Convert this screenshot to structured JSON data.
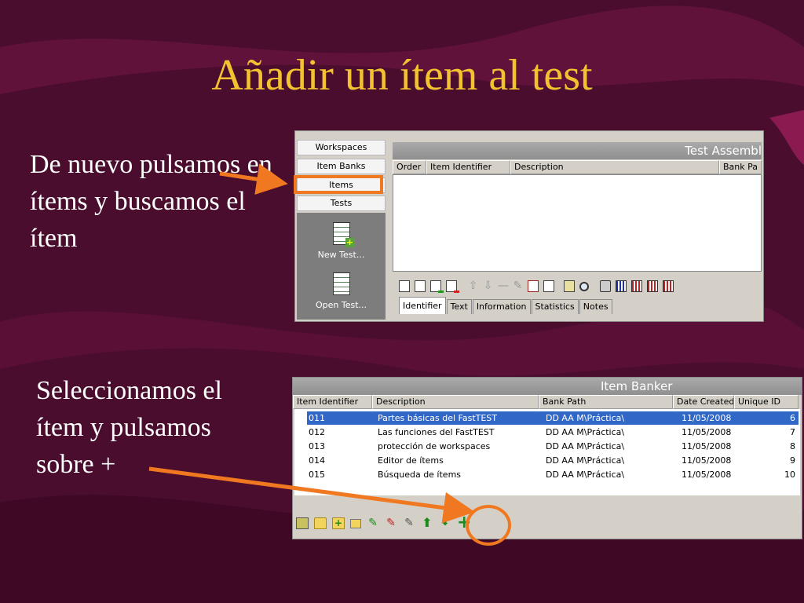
{
  "slide": {
    "title": "Añadir un ítem al test",
    "caption_1": "De nuevo pulsamos en ítems y buscamos el ítem",
    "caption_2": "Seleccionamos el ítem y pulsamos sobre +"
  },
  "colors": {
    "background": "#4a0d2e",
    "title": "#f2c230",
    "highlight": "#f07820",
    "selection": "#3168c8"
  },
  "test_assembler": {
    "nav": [
      "Workspaces",
      "Item Banks",
      "Items",
      "Tests"
    ],
    "selected_nav": "Items",
    "shortcuts": [
      {
        "label": "New Test...",
        "icon": "new-test-icon"
      },
      {
        "label": "Open Test...",
        "icon": "open-test-icon"
      }
    ],
    "title": "Test Assembl",
    "columns": [
      "Order",
      "Item Identifier",
      "Description",
      "Bank Pa"
    ],
    "tabs": [
      "Identifier",
      "Text",
      "Information",
      "Statistics",
      "Notes"
    ],
    "active_tab": "Identifier"
  },
  "item_banker": {
    "title": "Item Banker",
    "columns": [
      "Item Identifier",
      "Description",
      "Bank Path",
      "Date Created",
      "Unique ID"
    ],
    "rows": [
      {
        "id": "011",
        "description": "Partes básicas del FastTEST",
        "bank_path": "DD AA M\\Práctica\\",
        "date": "11/05/2008",
        "uid": "6",
        "selected": true
      },
      {
        "id": "012",
        "description": "Las funciones del FastTEST",
        "bank_path": "DD AA M\\Práctica\\",
        "date": "11/05/2008",
        "uid": "7",
        "selected": false
      },
      {
        "id": "013",
        "description": "protección de workspaces",
        "bank_path": "DD AA M\\Práctica\\",
        "date": "11/05/2008",
        "uid": "8",
        "selected": false
      },
      {
        "id": "014",
        "description": "Editor de ítems",
        "bank_path": "DD AA M\\Práctica\\",
        "date": "11/05/2008",
        "uid": "9",
        "selected": false
      },
      {
        "id": "015",
        "description": "Búsqueda de ítems",
        "bank_path": "DD AA M\\Práctica\\",
        "date": "11/05/2008",
        "uid": "10",
        "selected": false
      }
    ],
    "add_symbol": "+"
  }
}
